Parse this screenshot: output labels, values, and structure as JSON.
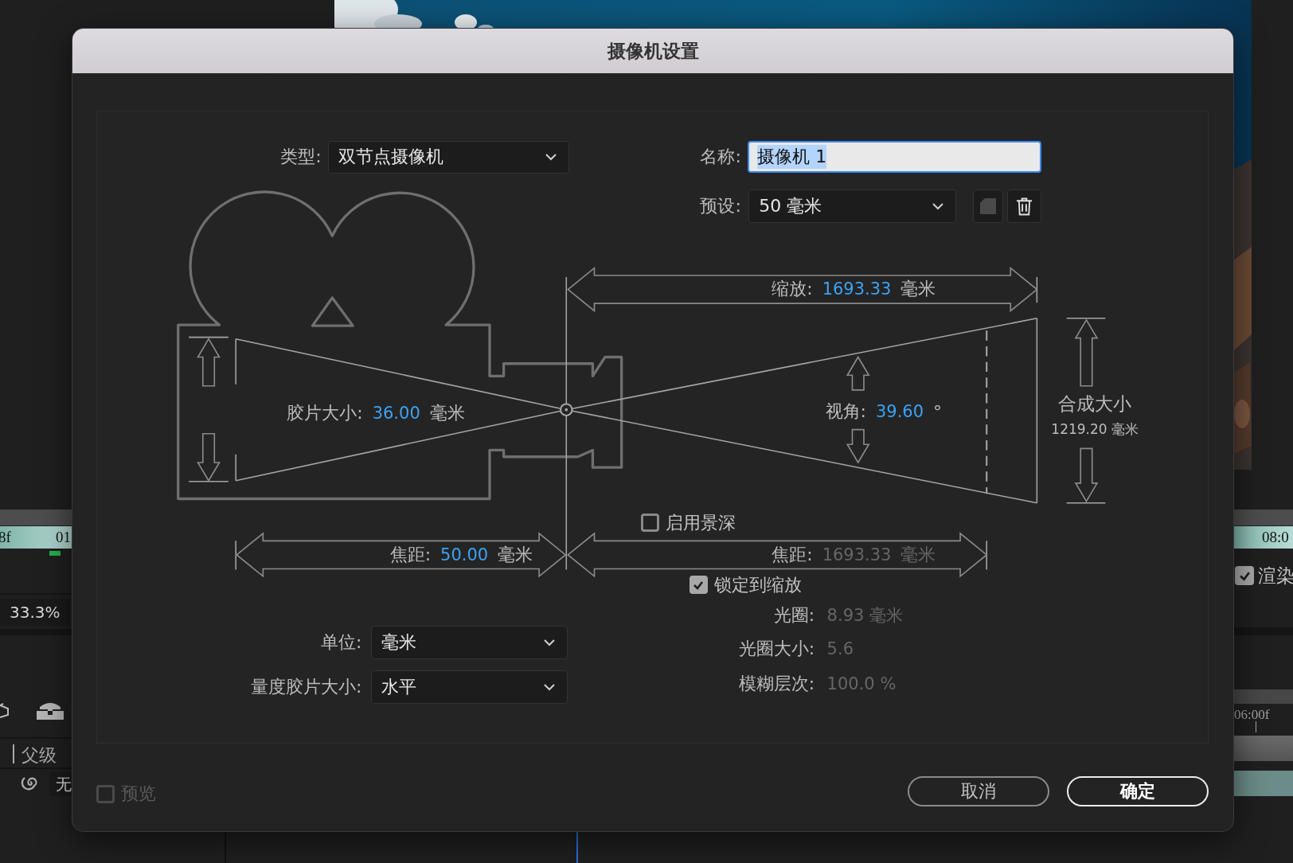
{
  "background": {
    "left_panel": {
      "timeline_labels": [
        "8f",
        "01"
      ],
      "zoom_level": "33.3%",
      "parent_header": "父级",
      "parent_value": "无"
    },
    "right_panel": {
      "timeline_label": "08:0",
      "render": {
        "label": "渲染",
        "checked": true
      },
      "time_label": "06:00f"
    }
  },
  "dialog": {
    "title": "摄像机设置",
    "type": {
      "label": "类型:",
      "value": "双节点摄像机"
    },
    "name": {
      "label": "名称:",
      "value": "摄像机 1",
      "highlighted": true
    },
    "preset": {
      "label": "预设:",
      "value": "50 毫米"
    },
    "zoom": {
      "label": "缩放:",
      "value": "1693.33",
      "unit": "毫米",
      "disabled": false
    },
    "film_size": {
      "label": "胶片大小:",
      "value": "36.00",
      "unit": "毫米",
      "disabled": false
    },
    "angle_of_view": {
      "label": "视角:",
      "value": "39.60",
      "unit": "°",
      "disabled": false
    },
    "comp_size": {
      "label": "合成大小",
      "value": "1219.20 毫米"
    },
    "depth_of_field": {
      "label": "启用景深",
      "checked": false
    },
    "focal_length": {
      "label": "焦距:",
      "value": "50.00",
      "unit": "毫米",
      "disabled": false
    },
    "focus_distance": {
      "label": "焦距:",
      "value": "1693.33",
      "unit": "毫米",
      "disabled": true
    },
    "lock_to_zoom": {
      "label": "锁定到缩放",
      "checked": true
    },
    "aperture": {
      "label": "光圈:",
      "value": "8.93 毫米",
      "disabled": true
    },
    "f_stop": {
      "label": "光圈大小:",
      "value": "5.6",
      "disabled": true
    },
    "blur_level": {
      "label": "模糊层次:",
      "value": "100.0 %",
      "disabled": true
    },
    "units": {
      "label": "单位:",
      "value": "毫米"
    },
    "measure_film_size": {
      "label": "量度胶片大小:",
      "value": "水平"
    },
    "preview": {
      "label": "预览",
      "checked": false,
      "disabled": true
    },
    "buttons": [
      {
        "label": "取消",
        "kind": "cancel"
      },
      {
        "label": "确定",
        "kind": "default"
      }
    ]
  }
}
